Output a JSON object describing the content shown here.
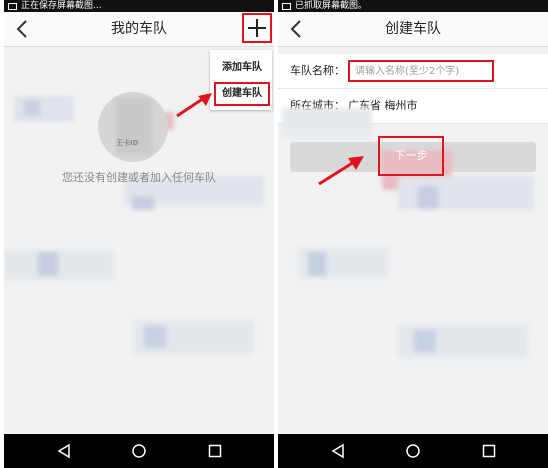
{
  "left_screen": {
    "status_text": "正在保存屏幕截图...",
    "title": "我的车队",
    "menu": {
      "add_label": "添加车队",
      "create_label": "创建车队"
    },
    "logo_text": "王卡ID",
    "empty_text": "您还没有创建或者加入任何车队"
  },
  "right_screen": {
    "status_text": "已抓取屏幕截图。",
    "title": "创建车队",
    "name_label": "车队名称：",
    "name_placeholder": "请输入名称(至少2个字)",
    "city_label": "所在城市：",
    "city_value": "广东省 梅州市",
    "next_label": "下一步"
  },
  "colors": {
    "highlight": "#e0141e",
    "titlebar": "#fafafa",
    "navbar": "#000000"
  },
  "icons": [
    "back-arrow-icon",
    "plus-icon",
    "nav-back-icon",
    "nav-home-icon",
    "nav-recents-icon",
    "red-arrow-icon"
  ]
}
